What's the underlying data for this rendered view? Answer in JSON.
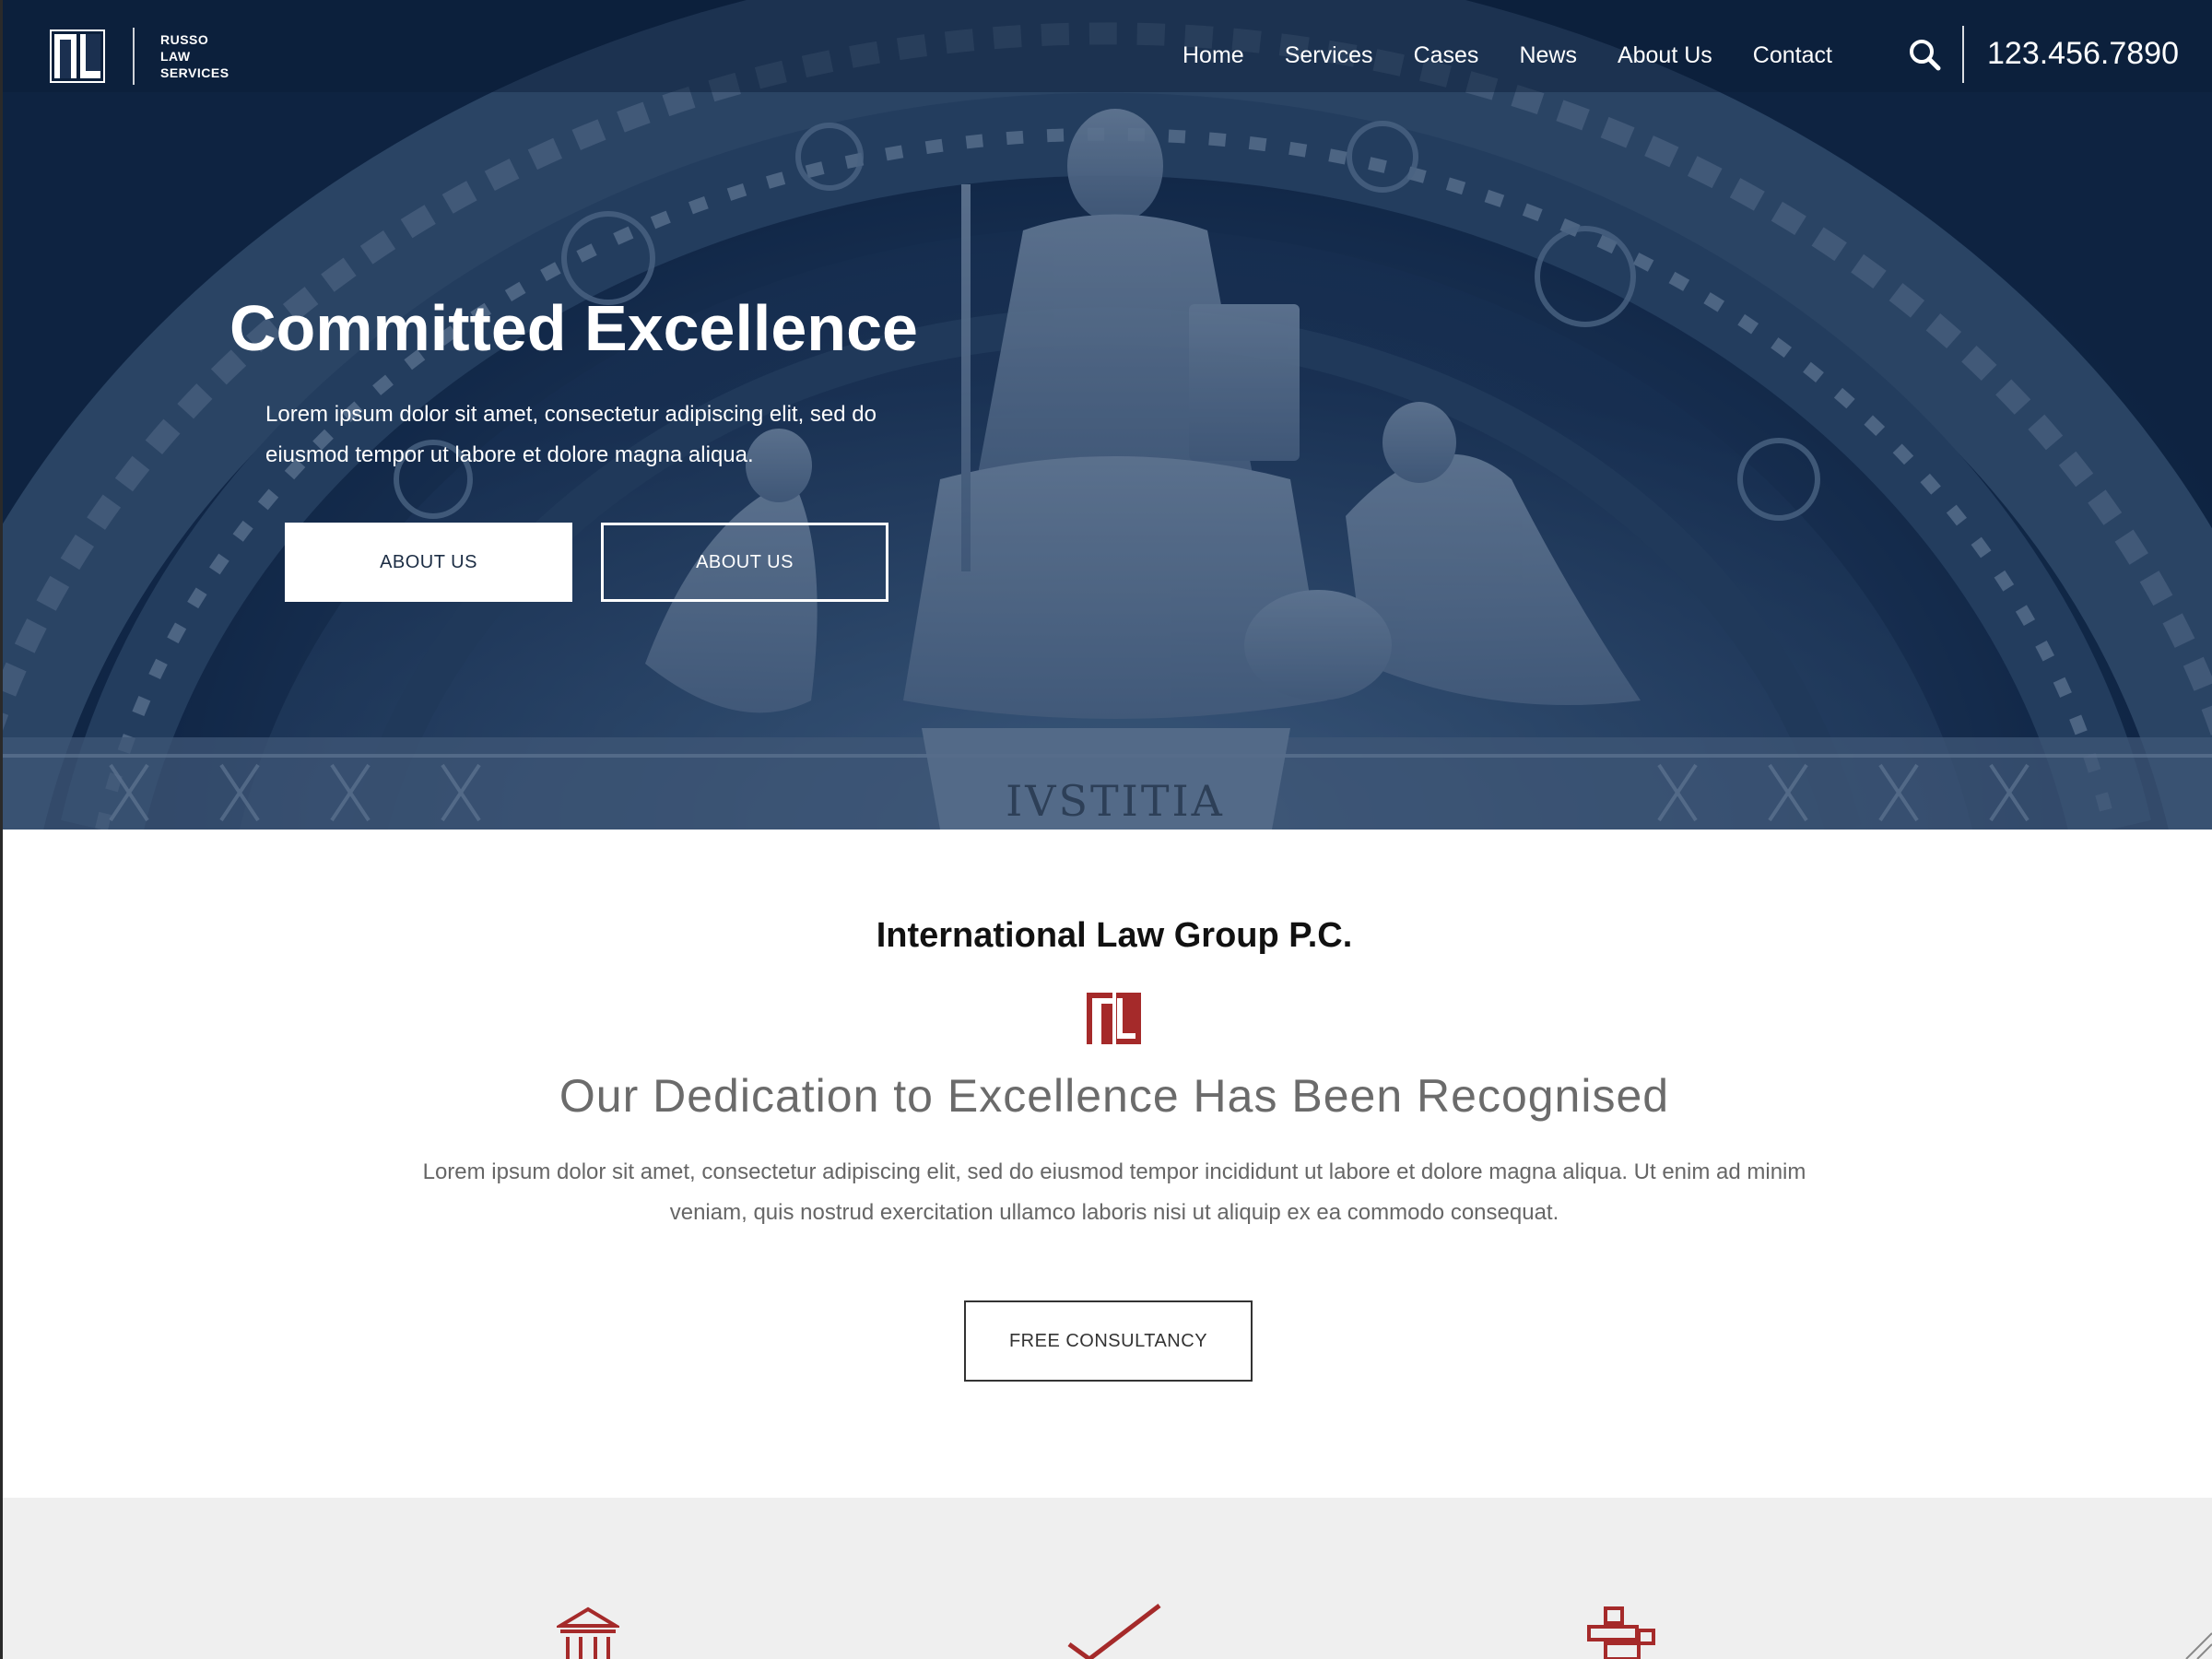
{
  "header": {
    "logo_lines": [
      "RUSSO",
      "LAW",
      "SERVICES"
    ],
    "nav": [
      "Home",
      "Services",
      "Cases",
      "News",
      "About Us",
      "Contact"
    ],
    "phone": "123.456.7890"
  },
  "hero": {
    "title": "Committed Excellence",
    "description": "Lorem ipsum dolor sit amet, consectetur adipiscing elit, sed do eiusmod tempor ut labore et dolore magna aliqua.",
    "primary_button": "ABOUT US",
    "secondary_button": "ABOUT US",
    "inscription": "IVSTITIA"
  },
  "intro": {
    "title": "International Law Group P.C.",
    "heading": "Our Dedication to Excellence Has Been Recognised",
    "description": "Lorem ipsum dolor sit amet, consectetur adipiscing elit, sed do eiusmod tempor incididunt ut labore et dolore magna aliqua. Ut enim ad minim veniam, quis nostrud exercitation ullamco laboris nisi ut aliquip ex ea commodo consequat.",
    "button": "FREE CONSULTANCY"
  },
  "features": {
    "icons": [
      "courthouse-icon",
      "checkmark-icon",
      "signpost-icon"
    ]
  },
  "colors": {
    "accent": "#a52a2a",
    "hero_navy": "#13294a",
    "features_bg": "#efefef"
  }
}
